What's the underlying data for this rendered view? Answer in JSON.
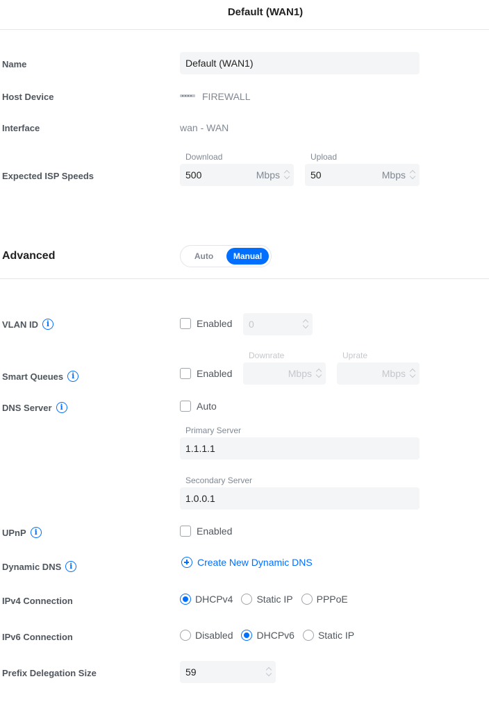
{
  "header": {
    "title": "Default (WAN1)"
  },
  "general": {
    "name_label": "Name",
    "name_value": "Default (WAN1)",
    "host_device_label": "Host Device",
    "host_device_value": "FIREWALL",
    "host_device_icon": "device-icon",
    "interface_label": "Interface",
    "interface_value": "wan - WAN",
    "isp_speeds_label": "Expected ISP Speeds",
    "download_label": "Download",
    "download_value": "500",
    "download_unit": "Mbps",
    "upload_label": "Upload",
    "upload_value": "50",
    "upload_unit": "Mbps"
  },
  "advanced": {
    "title": "Advanced",
    "mode_options": [
      "Auto",
      "Manual"
    ],
    "mode_selected": "Manual",
    "accent_color": "#006fff",
    "vlan": {
      "label": "VLAN ID",
      "checkbox_label": "Enabled",
      "checked": false,
      "value": "0"
    },
    "smart_queues": {
      "label": "Smart Queues",
      "checkbox_label": "Enabled",
      "checked": false,
      "downrate_label": "Downrate",
      "downrate_unit": "Mbps",
      "uprate_label": "Uprate",
      "uprate_unit": "Mbps"
    },
    "dns": {
      "label": "DNS Server",
      "checkbox_label": "Auto",
      "checked": false,
      "primary_label": "Primary Server",
      "primary_value": "1.1.1.1",
      "secondary_label": "Secondary Server",
      "secondary_value": "1.0.0.1"
    },
    "upnp": {
      "label": "UPnP",
      "checkbox_label": "Enabled",
      "checked": false
    },
    "dynamic_dns": {
      "label": "Dynamic DNS",
      "link_label": "Create New Dynamic DNS"
    },
    "ipv4": {
      "label": "IPv4 Connection",
      "options": [
        "DHCPv4",
        "Static IP",
        "PPPoE"
      ],
      "selected": "DHCPv4"
    },
    "ipv6": {
      "label": "IPv6 Connection",
      "options": [
        "Disabled",
        "DHCPv6",
        "Static IP"
      ],
      "selected": "DHCPv6"
    },
    "prefix": {
      "label": "Prefix Delegation Size",
      "value": "59"
    }
  }
}
